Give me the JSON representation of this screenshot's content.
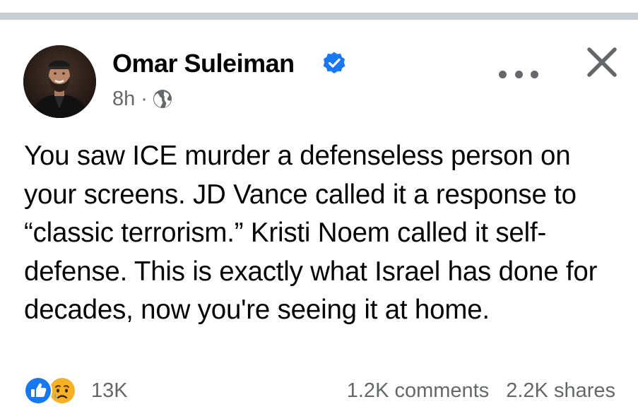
{
  "post": {
    "author": "Omar Suleiman",
    "verified": true,
    "time": "8h",
    "separator": "·",
    "audience_icon": "globe-icon",
    "body": "You saw ICE murder a defenseless person on your screens. JD Vance called it a response to “classic terrorism.” Kristi Noem called it self-defense. This is exactly what Israel has done for decades, now you're seeing it at home."
  },
  "header_actions": {
    "more_icon": "more-horizontal-icon",
    "close_icon": "close-icon"
  },
  "footer": {
    "reaction_icons": [
      "like-icon",
      "sad-icon"
    ],
    "reaction_count": "13K",
    "comments": "1.2K comments",
    "shares": "2.2K shares"
  },
  "colors": {
    "text": "#050505",
    "secondary_text": "#65676b",
    "facebook_blue": "#1877f2",
    "divider": "#c9ccd1",
    "sad_yellow": "#f7b125"
  }
}
